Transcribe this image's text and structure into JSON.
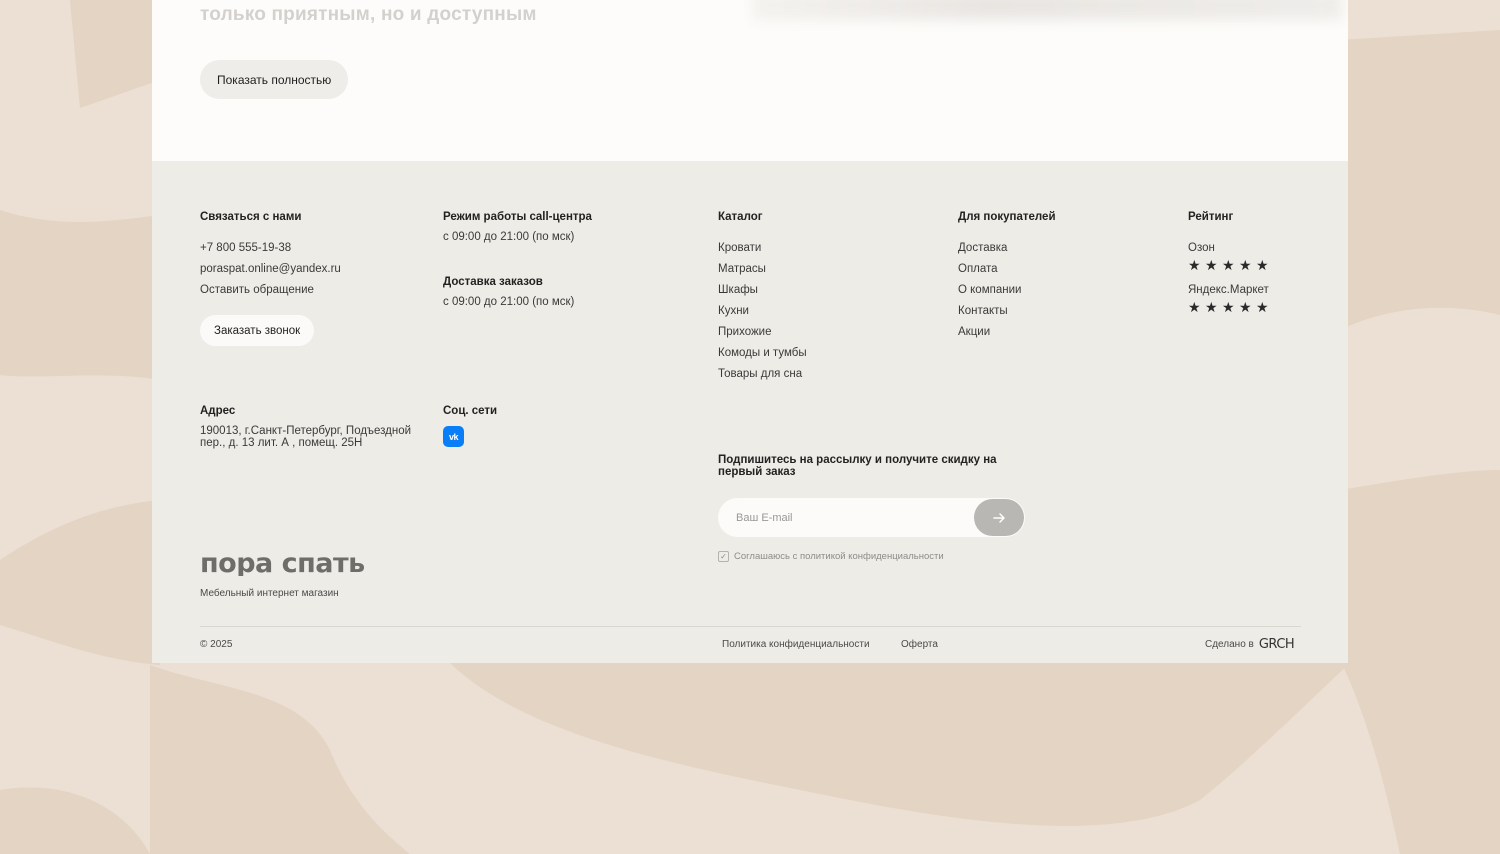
{
  "top": {
    "faded_text": "только приятным, но и доступным",
    "show_more_label": "Показать полностью"
  },
  "contact": {
    "heading": "Связаться с нами",
    "phone": "+7 800 555-19-38",
    "email": "poraspat.online@yandex.ru",
    "request_link": "Оставить обращение",
    "callback_button": "Заказать звонок"
  },
  "hours": {
    "callcenter_heading": "Режим работы call-центра",
    "callcenter_time": "с 09:00 до 21:00 (по мск)",
    "delivery_heading": "Доставка заказов",
    "delivery_time": "с 09:00 до 21:00 (по мск)"
  },
  "address": {
    "heading": "Адрес",
    "text": "190013, г.Санкт-Петербург, Подъездной пер., д. 13 лит. А , помещ. 25Н"
  },
  "social": {
    "heading": "Соц. сети",
    "vk_label": "vk"
  },
  "catalog": {
    "heading": "Каталог",
    "items": [
      "Кровати",
      "Матрасы",
      "Шкафы",
      "Кухни",
      "Прихожие",
      "Комоды и тумбы",
      "Товары для сна"
    ]
  },
  "buyers": {
    "heading": "Для покупателей",
    "items": [
      "Доставка",
      "Оплата",
      "О компании",
      "Контакты",
      "Акции"
    ]
  },
  "rating": {
    "heading": "Рейтинг",
    "sources": [
      {
        "name": "Озон",
        "stars": 5
      },
      {
        "name": "Яндекс.Маркет",
        "stars": 5
      }
    ]
  },
  "newsletter": {
    "heading": "Подпишитесь на рассылку и получите скидку на первый заказ",
    "placeholder": "Ваш E-mail",
    "consent": "Соглашаюсь с политикой конфиденциальности"
  },
  "brand": {
    "logo_text": "пора спать",
    "tagline": "Мебельный интернет магазин"
  },
  "bottom": {
    "copyright": "© 2025",
    "privacy": "Политика конфиденциальности",
    "offer": "Оферта",
    "made_by": "Сделано в",
    "studio": "GRCH"
  },
  "colors": {
    "page_bg": "#ecdfd3",
    "footer_bg": "#eeece7",
    "vk_blue": "#0a7ef7"
  }
}
